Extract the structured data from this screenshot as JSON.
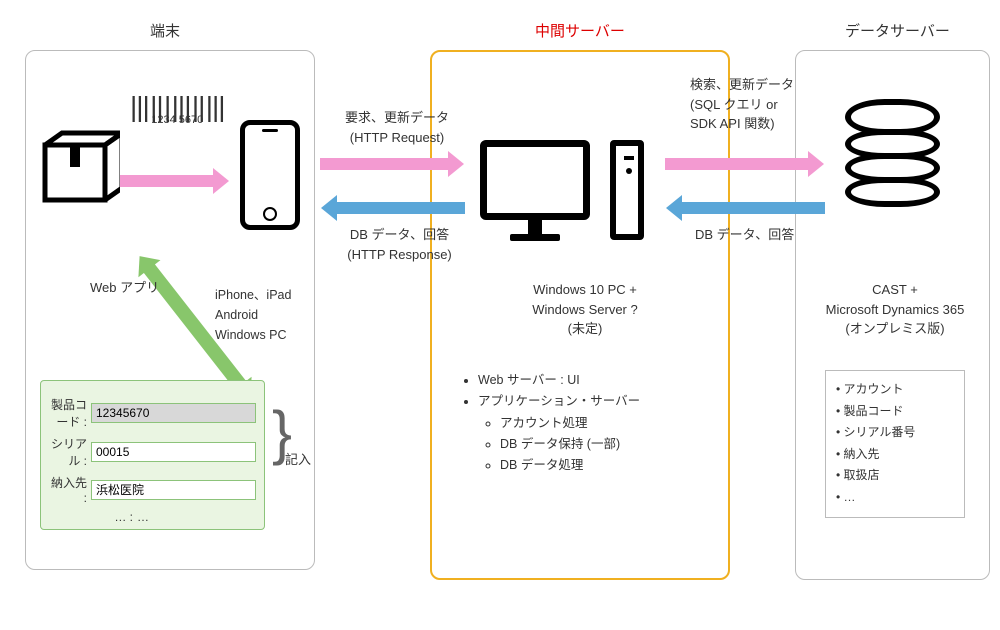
{
  "columns": {
    "left": {
      "title": "端末"
    },
    "mid": {
      "title": "中間サーバー"
    },
    "right": {
      "title": "データサーバー"
    }
  },
  "terminal": {
    "barcode_digits": "1234 5670",
    "webapp_label": "Web アプリ",
    "device_list": "iPhone、iPad\nAndroid\nWindows PC",
    "kinyu_label": "記入",
    "form": {
      "product_code_label": "製品コード :",
      "product_code_value": "12345670",
      "serial_label": "シリアル :",
      "serial_value": "00015",
      "dest_label": "納入先 :",
      "dest_value": "浜松医院",
      "etc_label": "… :",
      "etc_value": "…"
    }
  },
  "flows": {
    "req": {
      "top": "要求、更新データ",
      "bottom": "(HTTP Request)"
    },
    "resp": {
      "top": "DB データ、回答",
      "bottom": "(HTTP Response)"
    },
    "query": {
      "line1": "検索、更新データ",
      "line2": "(SQL クエリ or",
      "line3": "SDK API 関数)"
    },
    "dbret": {
      "top": "DB データ、回答"
    }
  },
  "middle": {
    "spec": "Windows 10 PC +\nWindows Server ?\n(未定)",
    "bullets": {
      "a": "Web サーバー : UI",
      "b": "アプリケーション・サーバー",
      "b1": "アカウント処理",
      "b2": "DB データ保持 (一部)",
      "b3": "DB データ処理"
    }
  },
  "right": {
    "spec": "CAST +\nMicrosoft Dynamics 365\n(オンプレミス版)",
    "data": {
      "a": "アカウント",
      "b": "製品コード",
      "c": "シリアル番号",
      "d": "納入先",
      "e": "取扱店",
      "f": "…"
    }
  }
}
